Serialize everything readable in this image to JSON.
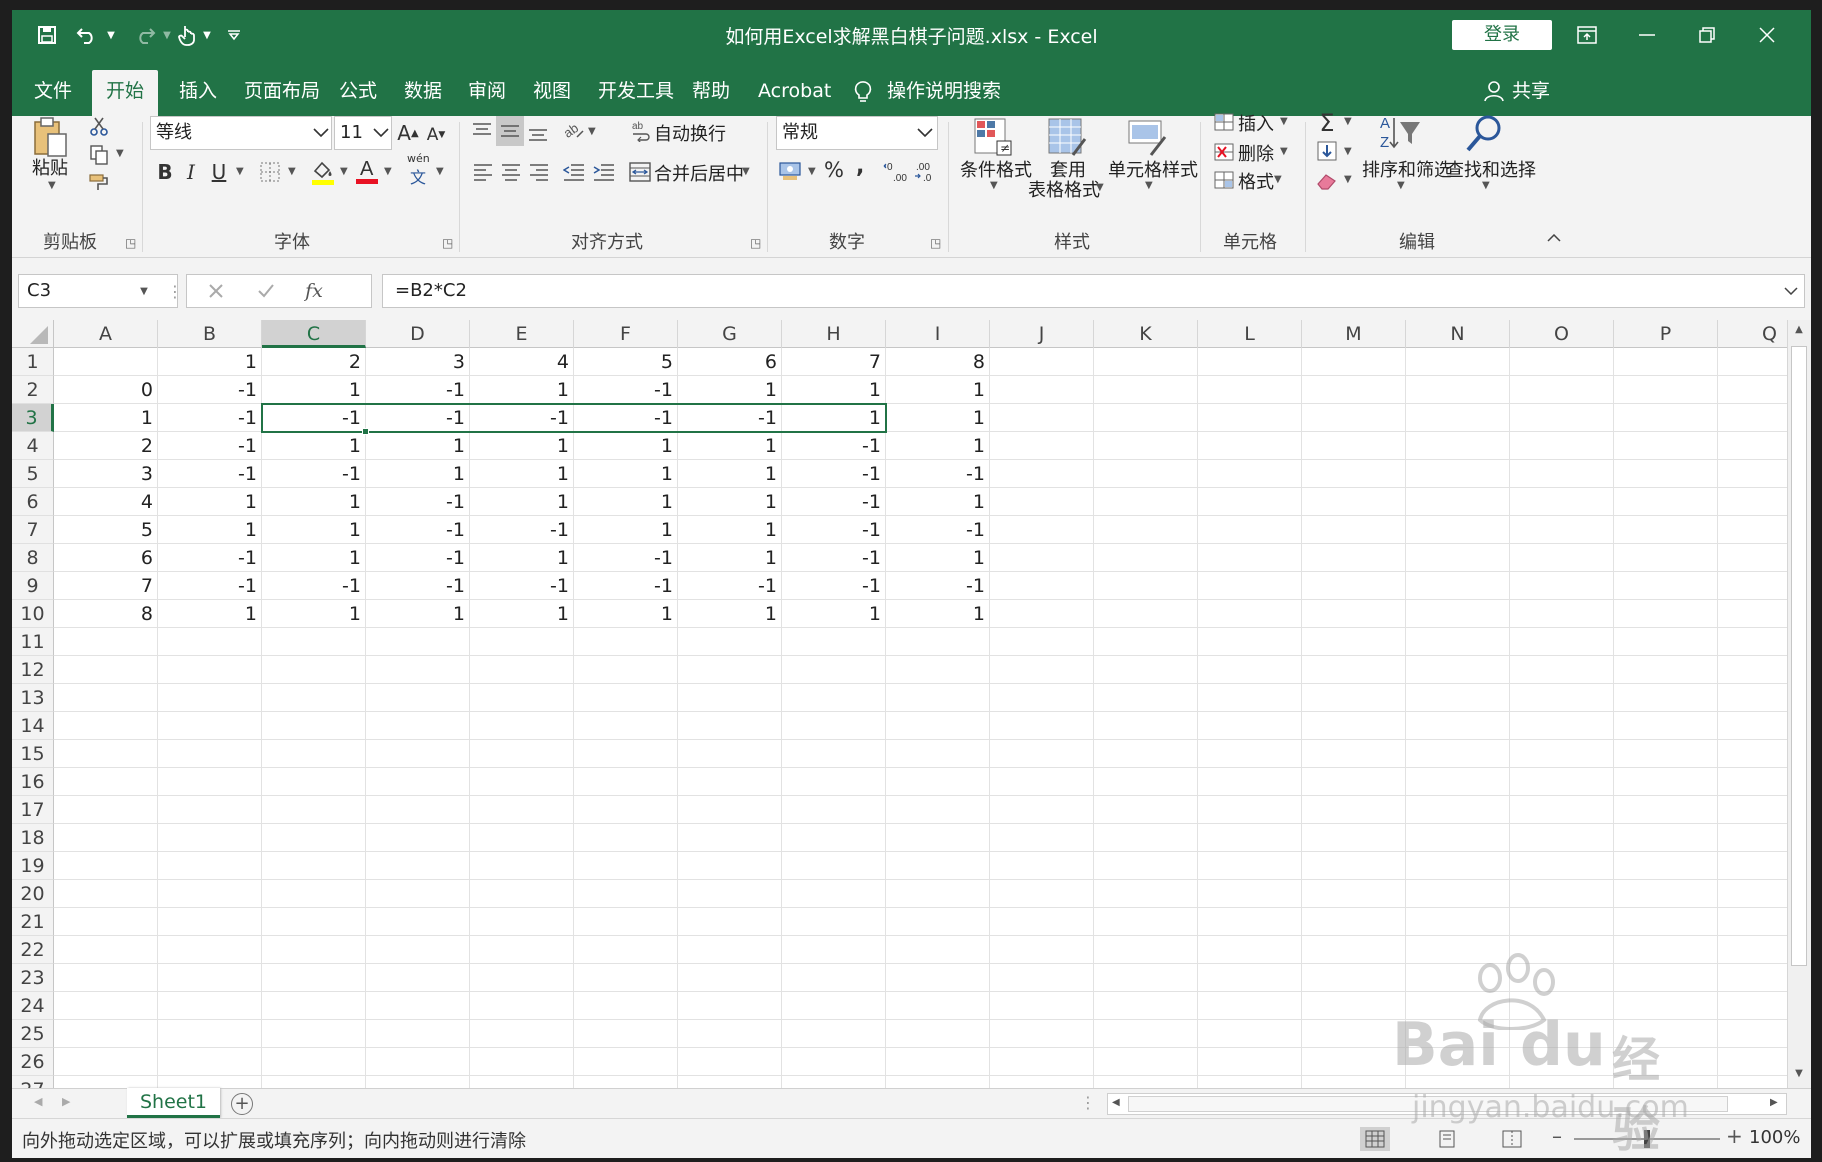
{
  "window": {
    "title": "如何用Excel求解黑白棋子问题.xlsx  -  Excel",
    "login_label": "登录",
    "share_label": "共享"
  },
  "tabs": [
    {
      "label": "文件"
    },
    {
      "label": "开始"
    },
    {
      "label": "插入"
    },
    {
      "label": "页面布局"
    },
    {
      "label": "公式"
    },
    {
      "label": "数据"
    },
    {
      "label": "审阅"
    },
    {
      "label": "视图"
    },
    {
      "label": "开发工具"
    },
    {
      "label": "帮助"
    },
    {
      "label": "Acrobat"
    }
  ],
  "active_tab": "开始",
  "tell_me": "操作说明搜索",
  "ribbon": {
    "clipboard": {
      "paste": "粘贴",
      "label": "剪贴板"
    },
    "font": {
      "name": "等线",
      "size": "11",
      "label": "字体",
      "phonetic": "wén",
      "phonetic_char": "文"
    },
    "alignment": {
      "wrap": "自动换行",
      "merge": "合并后居中",
      "label": "对齐方式"
    },
    "number": {
      "format": "常规",
      "label": "数字",
      "percent": "%",
      "comma": ","
    },
    "styles": {
      "conditional": "条件格式",
      "table_1": "套用",
      "table_2": "表格格式",
      "cell_styles": "单元格样式",
      "label": "样式"
    },
    "cells": {
      "insert": "插入",
      "delete": "删除",
      "format": "格式",
      "label": "单元格"
    },
    "editing": {
      "sort": "排序和筛选",
      "find": "查找和选择",
      "label": "编辑"
    }
  },
  "formula_bar": {
    "name_box": "C3",
    "formula": "=B2*C2",
    "fx": "fx"
  },
  "columns": [
    "A",
    "B",
    "C",
    "D",
    "E",
    "F",
    "G",
    "H",
    "I",
    "J",
    "K",
    "L",
    "M",
    "N",
    "O",
    "P",
    "Q"
  ],
  "rows": [
    "1",
    "2",
    "3",
    "4",
    "5",
    "6",
    "7",
    "8",
    "9",
    "10",
    "11",
    "12",
    "13",
    "14",
    "15",
    "16",
    "17",
    "18",
    "19",
    "20",
    "21",
    "22",
    "23",
    "24",
    "25",
    "26",
    "27"
  ],
  "selected_col": "C",
  "selected_row": "3",
  "cells": [
    [
      "",
      "1",
      "2",
      "3",
      "4",
      "5",
      "6",
      "7",
      "8"
    ],
    [
      "0",
      "-1",
      "1",
      "-1",
      "1",
      "-1",
      "1",
      "1",
      "1"
    ],
    [
      "1",
      "-1",
      "-1",
      "-1",
      "-1",
      "-1",
      "-1",
      "1",
      "1"
    ],
    [
      "2",
      "-1",
      "1",
      "1",
      "1",
      "1",
      "1",
      "-1",
      "1"
    ],
    [
      "3",
      "-1",
      "-1",
      "1",
      "1",
      "1",
      "1",
      "-1",
      "-1"
    ],
    [
      "4",
      "1",
      "1",
      "-1",
      "1",
      "1",
      "1",
      "-1",
      "1"
    ],
    [
      "5",
      "1",
      "1",
      "-1",
      "-1",
      "1",
      "1",
      "-1",
      "-1"
    ],
    [
      "6",
      "-1",
      "1",
      "-1",
      "1",
      "-1",
      "1",
      "-1",
      "1"
    ],
    [
      "7",
      "-1",
      "-1",
      "-1",
      "-1",
      "-1",
      "-1",
      "-1",
      "-1"
    ],
    [
      "8",
      "1",
      "1",
      "1",
      "1",
      "1",
      "1",
      "1",
      "1"
    ]
  ],
  "sheets": [
    {
      "label": "Sheet1"
    }
  ],
  "status": {
    "message": "向外拖动选定区域，可以扩展或填充序列；向内拖动则进行清除",
    "zoom": "100%"
  },
  "watermark": {
    "brand": "Bai",
    "brand2": "du",
    "cn": "经验",
    "url": "jingyan.baidu.com"
  },
  "colors": {
    "accent": "#217346",
    "ribbon_bg": "#f3f3f3"
  }
}
